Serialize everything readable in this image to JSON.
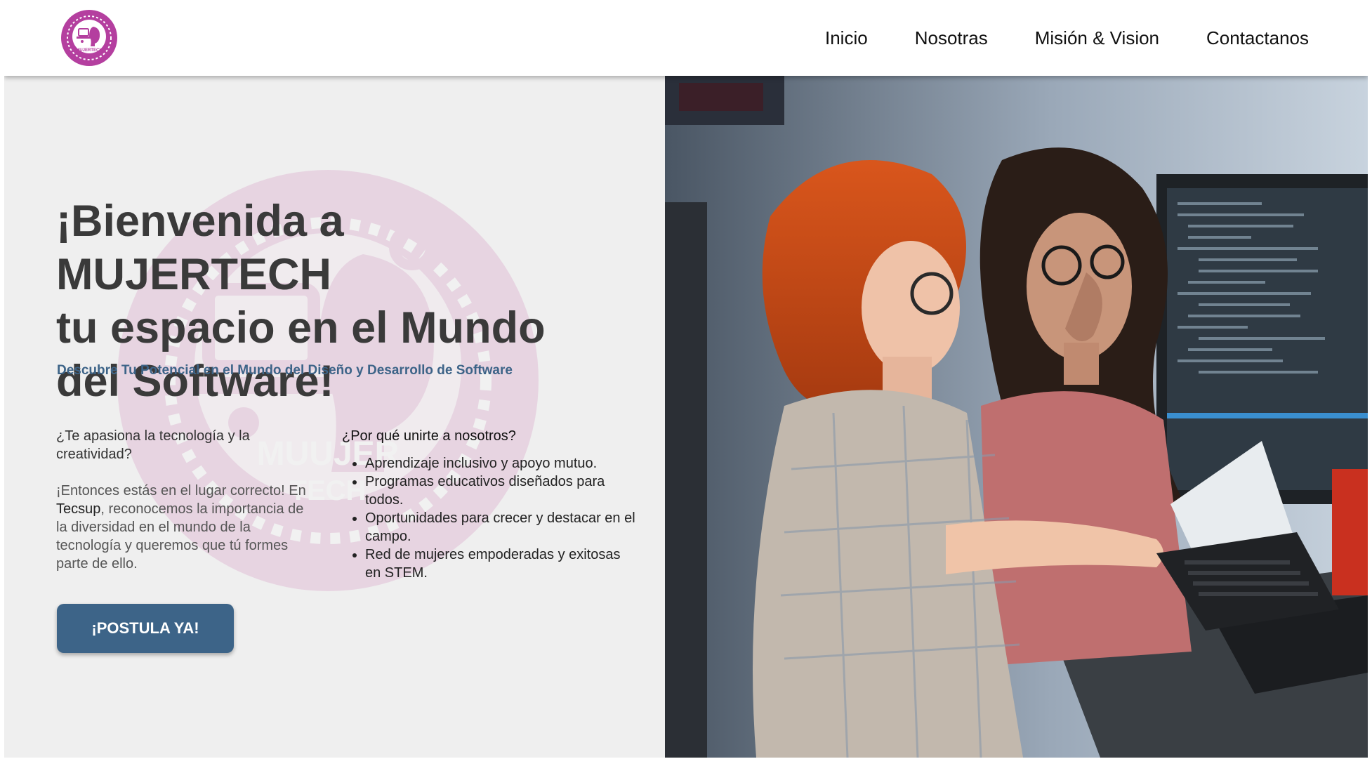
{
  "header": {
    "logo_alt": "MUJERTECH",
    "nav": [
      {
        "label": "Inicio"
      },
      {
        "label": "Nosotras"
      },
      {
        "label": "Misión & Vision"
      },
      {
        "label": "Contactanos"
      }
    ]
  },
  "hero": {
    "title_line1": "¡Bienvenida a MUJERTECH",
    "title_line2": "tu espacio en el Mundo",
    "title_line3": "del Software!",
    "subtitle": "Descubre Tu Potencial en el Mundo del Diseño y Desarrollo de Software",
    "question1": "¿Te apasiona la tecnología y la creatividad?",
    "para_before": "¡Entonces estás en el lugar correcto! En ",
    "para_brand": "Tecsup",
    "para_after": ", reconocemos la importancia de la diversidad en el mundo de la tecnología y queremos que tú formes parte de ello.",
    "question2": "¿Por qué unirte a nosotros?",
    "benefits": [
      "Aprendizaje inclusivo y apoyo mutuo.",
      "Programas educativos diseñados para todos.",
      "Oportunidades para crecer y destacar en el campo.",
      "Red de mujeres empoderadas y exitosas en STEM."
    ],
    "cta_label": "¡POSTULA YA!"
  },
  "watermark_text": [
    "MUUJER",
    "TECH"
  ],
  "colors": {
    "brand_magenta": "#b43f9f",
    "accent_blue": "#3d6488",
    "bg_left": "#efefef"
  }
}
